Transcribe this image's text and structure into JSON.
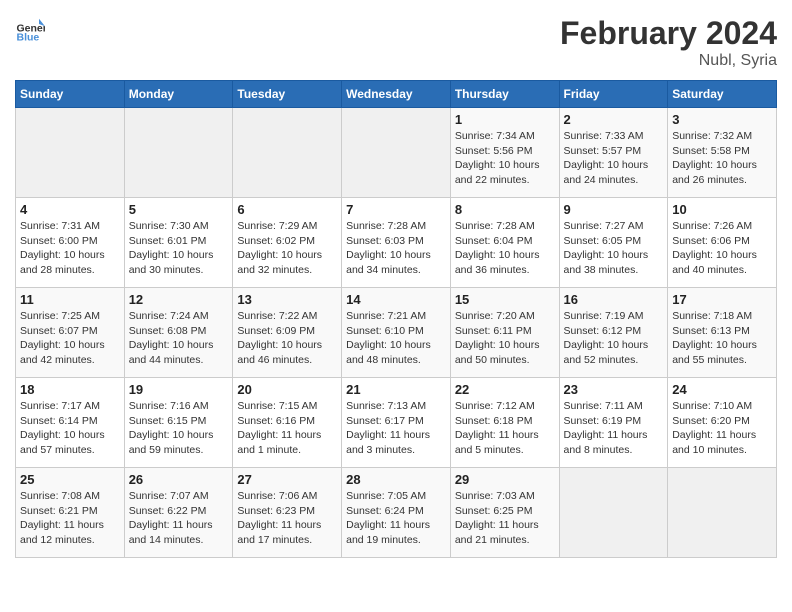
{
  "header": {
    "logo_general": "General",
    "logo_blue": "Blue",
    "title": "February 2024",
    "location": "Nubl, Syria"
  },
  "weekdays": [
    "Sunday",
    "Monday",
    "Tuesday",
    "Wednesday",
    "Thursday",
    "Friday",
    "Saturday"
  ],
  "weeks": [
    [
      {
        "day": "",
        "info": ""
      },
      {
        "day": "",
        "info": ""
      },
      {
        "day": "",
        "info": ""
      },
      {
        "day": "",
        "info": ""
      },
      {
        "day": "1",
        "info": "Sunrise: 7:34 AM\nSunset: 5:56 PM\nDaylight: 10 hours\nand 22 minutes."
      },
      {
        "day": "2",
        "info": "Sunrise: 7:33 AM\nSunset: 5:57 PM\nDaylight: 10 hours\nand 24 minutes."
      },
      {
        "day": "3",
        "info": "Sunrise: 7:32 AM\nSunset: 5:58 PM\nDaylight: 10 hours\nand 26 minutes."
      }
    ],
    [
      {
        "day": "4",
        "info": "Sunrise: 7:31 AM\nSunset: 6:00 PM\nDaylight: 10 hours\nand 28 minutes."
      },
      {
        "day": "5",
        "info": "Sunrise: 7:30 AM\nSunset: 6:01 PM\nDaylight: 10 hours\nand 30 minutes."
      },
      {
        "day": "6",
        "info": "Sunrise: 7:29 AM\nSunset: 6:02 PM\nDaylight: 10 hours\nand 32 minutes."
      },
      {
        "day": "7",
        "info": "Sunrise: 7:28 AM\nSunset: 6:03 PM\nDaylight: 10 hours\nand 34 minutes."
      },
      {
        "day": "8",
        "info": "Sunrise: 7:28 AM\nSunset: 6:04 PM\nDaylight: 10 hours\nand 36 minutes."
      },
      {
        "day": "9",
        "info": "Sunrise: 7:27 AM\nSunset: 6:05 PM\nDaylight: 10 hours\nand 38 minutes."
      },
      {
        "day": "10",
        "info": "Sunrise: 7:26 AM\nSunset: 6:06 PM\nDaylight: 10 hours\nand 40 minutes."
      }
    ],
    [
      {
        "day": "11",
        "info": "Sunrise: 7:25 AM\nSunset: 6:07 PM\nDaylight: 10 hours\nand 42 minutes."
      },
      {
        "day": "12",
        "info": "Sunrise: 7:24 AM\nSunset: 6:08 PM\nDaylight: 10 hours\nand 44 minutes."
      },
      {
        "day": "13",
        "info": "Sunrise: 7:22 AM\nSunset: 6:09 PM\nDaylight: 10 hours\nand 46 minutes."
      },
      {
        "day": "14",
        "info": "Sunrise: 7:21 AM\nSunset: 6:10 PM\nDaylight: 10 hours\nand 48 minutes."
      },
      {
        "day": "15",
        "info": "Sunrise: 7:20 AM\nSunset: 6:11 PM\nDaylight: 10 hours\nand 50 minutes."
      },
      {
        "day": "16",
        "info": "Sunrise: 7:19 AM\nSunset: 6:12 PM\nDaylight: 10 hours\nand 52 minutes."
      },
      {
        "day": "17",
        "info": "Sunrise: 7:18 AM\nSunset: 6:13 PM\nDaylight: 10 hours\nand 55 minutes."
      }
    ],
    [
      {
        "day": "18",
        "info": "Sunrise: 7:17 AM\nSunset: 6:14 PM\nDaylight: 10 hours\nand 57 minutes."
      },
      {
        "day": "19",
        "info": "Sunrise: 7:16 AM\nSunset: 6:15 PM\nDaylight: 10 hours\nand 59 minutes."
      },
      {
        "day": "20",
        "info": "Sunrise: 7:15 AM\nSunset: 6:16 PM\nDaylight: 11 hours\nand 1 minute."
      },
      {
        "day": "21",
        "info": "Sunrise: 7:13 AM\nSunset: 6:17 PM\nDaylight: 11 hours\nand 3 minutes."
      },
      {
        "day": "22",
        "info": "Sunrise: 7:12 AM\nSunset: 6:18 PM\nDaylight: 11 hours\nand 5 minutes."
      },
      {
        "day": "23",
        "info": "Sunrise: 7:11 AM\nSunset: 6:19 PM\nDaylight: 11 hours\nand 8 minutes."
      },
      {
        "day": "24",
        "info": "Sunrise: 7:10 AM\nSunset: 6:20 PM\nDaylight: 11 hours\nand 10 minutes."
      }
    ],
    [
      {
        "day": "25",
        "info": "Sunrise: 7:08 AM\nSunset: 6:21 PM\nDaylight: 11 hours\nand 12 minutes."
      },
      {
        "day": "26",
        "info": "Sunrise: 7:07 AM\nSunset: 6:22 PM\nDaylight: 11 hours\nand 14 minutes."
      },
      {
        "day": "27",
        "info": "Sunrise: 7:06 AM\nSunset: 6:23 PM\nDaylight: 11 hours\nand 17 minutes."
      },
      {
        "day": "28",
        "info": "Sunrise: 7:05 AM\nSunset: 6:24 PM\nDaylight: 11 hours\nand 19 minutes."
      },
      {
        "day": "29",
        "info": "Sunrise: 7:03 AM\nSunset: 6:25 PM\nDaylight: 11 hours\nand 21 minutes."
      },
      {
        "day": "",
        "info": ""
      },
      {
        "day": "",
        "info": ""
      }
    ]
  ]
}
